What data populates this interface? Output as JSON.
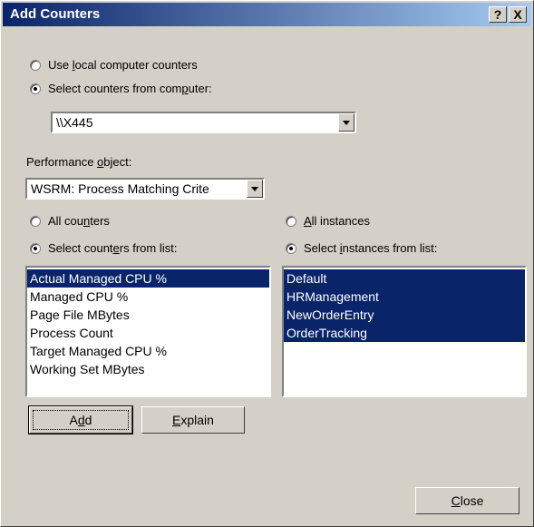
{
  "window": {
    "title": "Add Counters",
    "help_button": "?",
    "close_button": "X"
  },
  "computer_source": {
    "option_local": {
      "pre": "Use ",
      "accel": "l",
      "post": "ocal computer counters",
      "selected": false
    },
    "option_remote": {
      "pre": "Select counters from com",
      "accel": "p",
      "post": "uter:",
      "selected": true
    },
    "computer_value": "\\\\X445"
  },
  "performance_object": {
    "label_pre": "Performance ",
    "label_accel": "o",
    "label_post": "bject:",
    "value": "WSRM: Process Matching Crite"
  },
  "counters": {
    "option_all": {
      "pre": "All cou",
      "accel": "n",
      "post": "ters",
      "selected": false
    },
    "option_list": {
      "pre": "Select count",
      "accel": "e",
      "post": "rs from list:",
      "selected": true
    },
    "items": [
      {
        "label": "Actual Managed CPU %",
        "selected": true
      },
      {
        "label": "Managed CPU %",
        "selected": false
      },
      {
        "label": "Page File MBytes",
        "selected": false
      },
      {
        "label": "Process Count",
        "selected": false
      },
      {
        "label": "Target Managed CPU %",
        "selected": false
      },
      {
        "label": "Working Set MBytes",
        "selected": false
      }
    ]
  },
  "instances": {
    "option_all": {
      "pre": "",
      "accel": "A",
      "post": "ll instances",
      "selected": false
    },
    "option_list": {
      "pre": "Select ",
      "accel": "i",
      "post": "nstances from list:",
      "selected": true
    },
    "items": [
      {
        "label": "Default",
        "selected": true
      },
      {
        "label": "HRManagement",
        "selected": true
      },
      {
        "label": "NewOrderEntry",
        "selected": true
      },
      {
        "label": "OrderTracking",
        "selected": true
      }
    ]
  },
  "buttons": {
    "add": {
      "pre": "A",
      "accel": "d",
      "post": "d"
    },
    "explain": {
      "pre": "",
      "accel": "E",
      "post": "xplain"
    },
    "close": {
      "pre": "",
      "accel": "C",
      "post": "lose"
    }
  }
}
